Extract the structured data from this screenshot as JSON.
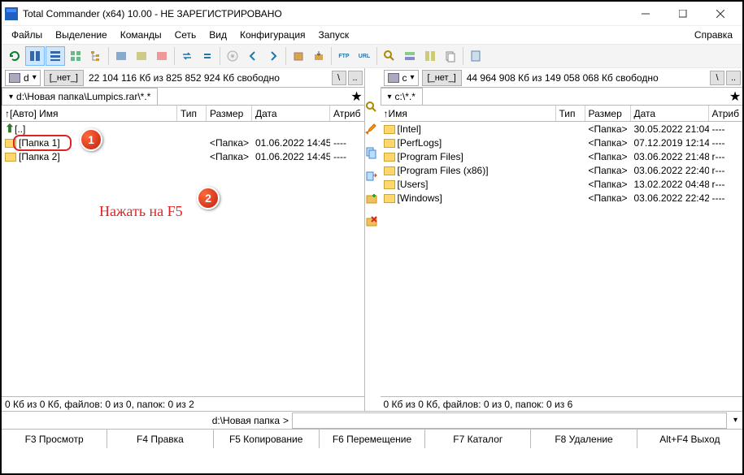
{
  "title": "Total Commander (x64) 10.00 - НЕ ЗАРЕГИСТРИРОВАНО",
  "menu": {
    "files": "Файлы",
    "sel": "Выделение",
    "cmds": "Команды",
    "net": "Сеть",
    "view": "Вид",
    "conf": "Конфигурация",
    "run": "Запуск",
    "help": "Справка"
  },
  "left": {
    "drive": "d",
    "none": "[_нет_]",
    "free": "22 104 116 Кб из 825 852 924 Кб свободно",
    "tab": "d:\\Новая папка\\Lumpics.rar\\*.*",
    "status": "0 Кб из 0 Кб, файлов: 0 из 0, папок: 0 из 2",
    "hdr_name": "[Авто] Имя",
    "hdr_type": "Тип",
    "hdr_size": "Размер",
    "hdr_date": "Дата",
    "hdr_attr": "Атриб",
    "rows": [
      {
        "name": "[..]",
        "size": "",
        "date": "",
        "attr": "",
        "up": true
      },
      {
        "name": "[Папка 1]",
        "size": "<Папка>",
        "date": "01.06.2022 14:45",
        "attr": "----",
        "up": false
      },
      {
        "name": "[Папка 2]",
        "size": "<Папка>",
        "date": "01.06.2022 14:45",
        "attr": "----",
        "up": false
      }
    ]
  },
  "right": {
    "drive": "c",
    "none": "[_нет_]",
    "free": "44 964 908 Кб из 149 058 068 Кб свободно",
    "tab": "c:\\*.*",
    "status": "0 Кб из 0 Кб, файлов: 0 из 0, папок: 0 из 6",
    "hdr_name": "Имя",
    "hdr_type": "Тип",
    "hdr_size": "Размер",
    "hdr_date": "Дата",
    "hdr_attr": "Атриб",
    "rows": [
      {
        "name": "[Intel]",
        "size": "<Папка>",
        "date": "30.05.2022 21:04",
        "attr": "----"
      },
      {
        "name": "[PerfLogs]",
        "size": "<Папка>",
        "date": "07.12.2019 12:14",
        "attr": "----"
      },
      {
        "name": "[Program Files]",
        "size": "<Папка>",
        "date": "03.06.2022 21:48",
        "attr": "r---"
      },
      {
        "name": "[Program Files (x86)]",
        "size": "<Папка>",
        "date": "03.06.2022 22:40",
        "attr": "r---"
      },
      {
        "name": "[Users]",
        "size": "<Папка>",
        "date": "13.02.2022 04:48",
        "attr": "r---"
      },
      {
        "name": "[Windows]",
        "size": "<Папка>",
        "date": "03.06.2022 22:42",
        "attr": "----"
      }
    ]
  },
  "cmdpath": "d:\\Новая папка",
  "fkeys": {
    "f3": "F3 Просмотр",
    "f4": "F4 Правка",
    "f5": "F5 Копирование",
    "f6": "F6 Перемещение",
    "f7": "F7 Каталог",
    "f8": "F8 Удаление",
    "altf4": "Alt+F4 Выход"
  },
  "annotation": "Нажать на F5",
  "callouts": {
    "one": "1",
    "two": "2"
  }
}
